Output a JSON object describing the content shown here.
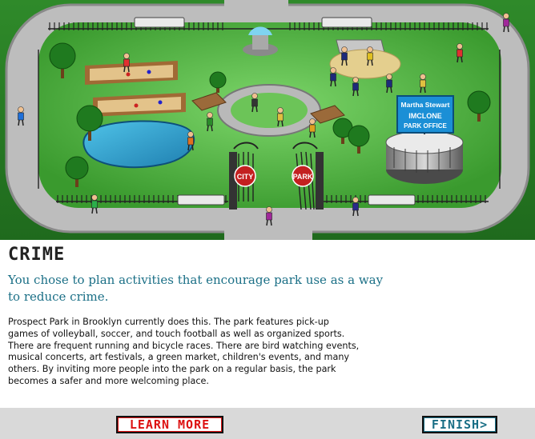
{
  "scene": {
    "gate_left_sign": "CITY",
    "gate_right_sign": "PARK",
    "billboard_line1": "Martha Stewart",
    "billboard_line2": "IMCLONE",
    "billboard_line3": "PARK OFFICE"
  },
  "content": {
    "heading": "CRIME",
    "lead": "You chose to plan activities that encourage park use as a way to reduce crime.",
    "body": "Prospect Park in Brooklyn currently does this. The park features pick-up games of volleyball, soccer, and touch football as well as organized sports. There are frequent running and bicycle races. There are bird watching events, musical concerts, art festivals, a green market, children's events, and many others. By inviting more people into the park on a regular basis, the park becomes a safer and more welcoming place."
  },
  "footer": {
    "learn_more": "LEARN MORE",
    "finish": "FINISH>"
  },
  "colors": {
    "accent": "#1a6f86",
    "learn_more": "#dd1111",
    "grass": "#4aa83a",
    "path": "#c8c8c8"
  }
}
